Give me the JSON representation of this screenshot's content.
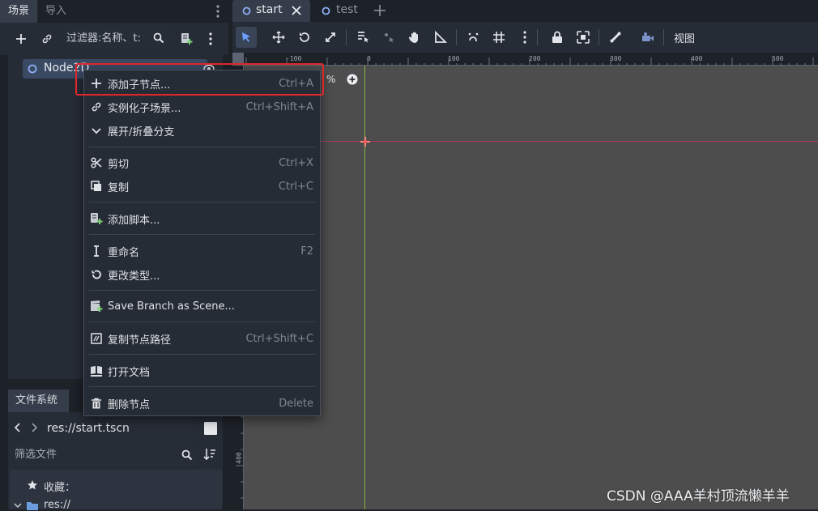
{
  "scene_dock": {
    "tabs": [
      "场景",
      "导入"
    ],
    "filter_placeholder": "过滤器:名称、t:",
    "root_node": "Node2D"
  },
  "editor": {
    "tabs": [
      "start",
      "test"
    ],
    "view_label": "视图",
    "zoom_suffix": "%"
  },
  "ruler": [
    "-100",
    "0",
    "100",
    "200",
    "300",
    "400",
    "500"
  ],
  "vruler": [
    "400"
  ],
  "context_menu": {
    "items": [
      {
        "label": "添加子节点...",
        "shortcut": "Ctrl+A"
      },
      {
        "label": "实例化子场景...",
        "shortcut": "Ctrl+Shift+A"
      },
      {
        "label": "展开/折叠分支",
        "shortcut": ""
      },
      {
        "label": "剪切",
        "shortcut": "Ctrl+X"
      },
      {
        "label": "复制",
        "shortcut": "Ctrl+C"
      },
      {
        "label": "添加脚本...",
        "shortcut": ""
      },
      {
        "label": "重命名",
        "shortcut": "F2"
      },
      {
        "label": "更改类型...",
        "shortcut": ""
      },
      {
        "label": "Save Branch as Scene...",
        "shortcut": ""
      },
      {
        "label": "复制节点路径",
        "shortcut": "Ctrl+Shift+C"
      },
      {
        "label": "打开文档",
        "shortcut": ""
      },
      {
        "label": "删除节点",
        "shortcut": "Delete"
      }
    ]
  },
  "filesystem": {
    "title": "文件系统",
    "path": "res://start.tscn",
    "filter_placeholder": "筛选文件",
    "favorites": "收藏：",
    "res_root": "res://"
  },
  "watermark": "CSDN @AAA羊村顶流懒羊羊",
  "colors": {
    "accent": "#5a8ff2",
    "highlight": "#e0262b",
    "canvas": "#4d4d4d",
    "dock": "#1d2229"
  }
}
